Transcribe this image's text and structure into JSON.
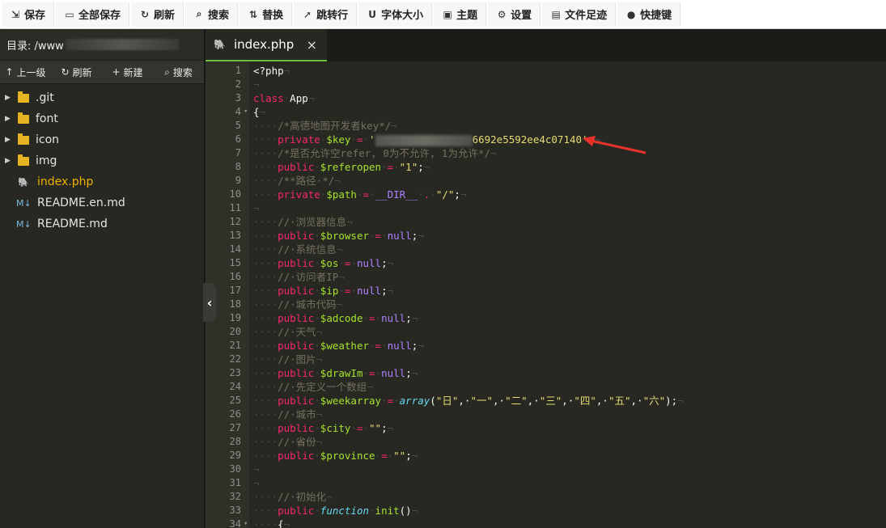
{
  "toolbar": {
    "items": [
      {
        "label": "保存",
        "icon": "save-icon",
        "glyph": "⇲"
      },
      {
        "label": "全部保存",
        "icon": "save-all-icon",
        "glyph": "▭"
      },
      {
        "label": "刷新",
        "icon": "refresh-icon",
        "glyph": "↻"
      },
      {
        "label": "搜索",
        "icon": "search-icon",
        "glyph": "⌕"
      },
      {
        "label": "替换",
        "icon": "replace-icon",
        "glyph": "⇅"
      },
      {
        "label": "跳转行",
        "icon": "goto-line-icon",
        "glyph": "➚"
      },
      {
        "label": "字体大小",
        "icon": "font-size-icon",
        "glyph": "U"
      },
      {
        "label": "主题",
        "icon": "theme-icon",
        "glyph": "▣"
      },
      {
        "label": "设置",
        "icon": "gear-icon",
        "glyph": "⚙"
      },
      {
        "label": "文件足迹",
        "icon": "history-icon",
        "glyph": "▤"
      },
      {
        "label": "快捷键",
        "icon": "help-icon",
        "glyph": "●"
      }
    ]
  },
  "sidebar": {
    "dir_label": "目录: /www",
    "actions": [
      {
        "label": "上一级",
        "icon": "up-arrow-icon",
        "glyph": "↑"
      },
      {
        "label": "刷新",
        "icon": "refresh-icon",
        "glyph": "↻"
      },
      {
        "label": "新建",
        "icon": "plus-icon",
        "glyph": "+"
      },
      {
        "label": "搜索",
        "icon": "search-icon",
        "glyph": "⌕"
      }
    ],
    "tree": [
      {
        "name": ".git",
        "type": "folder"
      },
      {
        "name": "font",
        "type": "folder"
      },
      {
        "name": "icon",
        "type": "folder"
      },
      {
        "name": "img",
        "type": "folder"
      },
      {
        "name": "index.php",
        "type": "php",
        "active": true
      },
      {
        "name": "README.en.md",
        "type": "md"
      },
      {
        "name": "README.md",
        "type": "md"
      }
    ]
  },
  "tabs": [
    {
      "label": "index.php",
      "close": "×"
    }
  ],
  "collapse_glyph": "‹",
  "code_lines": [
    {
      "n": "1",
      "tokens": [
        [
          "",
          "<?php"
        ]
      ]
    },
    {
      "n": "2",
      "tokens": []
    },
    {
      "n": "3",
      "tokens": [
        [
          "kw",
          "class"
        ],
        [
          "ws",
          "·"
        ],
        [
          "",
          "App"
        ]
      ]
    },
    {
      "n": "4",
      "fold": true,
      "tokens": [
        [
          "",
          "{"
        ]
      ]
    },
    {
      "n": "5",
      "tokens": [
        [
          "ws",
          "····"
        ],
        [
          "cm",
          "/*高德地图开发者key*/"
        ]
      ]
    },
    {
      "n": "6",
      "key": true,
      "tokens": [
        [
          "ws",
          "····"
        ],
        [
          "kw",
          "private"
        ],
        [
          "ws",
          "·"
        ],
        [
          "var",
          "$key"
        ],
        [
          "ws",
          "·"
        ],
        [
          "kw",
          "="
        ],
        [
          "ws",
          "·"
        ],
        [
          "str",
          "'"
        ],
        [
          "redact",
          ""
        ],
        [
          "str",
          "6692e5592ee4c07140'"
        ],
        [
          "",
          ";"
        ]
      ]
    },
    {
      "n": "7",
      "tokens": [
        [
          "ws",
          "····"
        ],
        [
          "cm",
          "/*是否允许空refer, 0为不允许, 1为允许*/"
        ]
      ]
    },
    {
      "n": "8",
      "tokens": [
        [
          "ws",
          "····"
        ],
        [
          "kw",
          "public"
        ],
        [
          "ws",
          "·"
        ],
        [
          "var",
          "$referopen"
        ],
        [
          "ws",
          "·"
        ],
        [
          "kw",
          "="
        ],
        [
          "ws",
          "·"
        ],
        [
          "str",
          "\"1\""
        ],
        [
          "",
          ";"
        ]
      ]
    },
    {
      "n": "9",
      "tokens": [
        [
          "ws",
          "····"
        ],
        [
          "cm",
          "/**路径·*/"
        ]
      ]
    },
    {
      "n": "10",
      "tokens": [
        [
          "ws",
          "····"
        ],
        [
          "kw",
          "private"
        ],
        [
          "ws",
          "·"
        ],
        [
          "var",
          "$path"
        ],
        [
          "ws",
          "·"
        ],
        [
          "kw",
          "="
        ],
        [
          "ws",
          "·"
        ],
        [
          "num",
          "__DIR__"
        ],
        [
          "ws",
          "·"
        ],
        [
          "kw",
          "."
        ],
        [
          "ws",
          "·"
        ],
        [
          "str",
          "\"/\""
        ],
        [
          "",
          ";"
        ]
      ]
    },
    {
      "n": "11",
      "tokens": []
    },
    {
      "n": "12",
      "tokens": [
        [
          "ws",
          "····"
        ],
        [
          "cm",
          "//·浏览器信息"
        ]
      ]
    },
    {
      "n": "13",
      "tokens": [
        [
          "ws",
          "····"
        ],
        [
          "kw",
          "public"
        ],
        [
          "ws",
          "·"
        ],
        [
          "var",
          "$browser"
        ],
        [
          "ws",
          "·"
        ],
        [
          "kw",
          "="
        ],
        [
          "ws",
          "·"
        ],
        [
          "num",
          "null"
        ],
        [
          "",
          ";"
        ]
      ]
    },
    {
      "n": "14",
      "tokens": [
        [
          "ws",
          "····"
        ],
        [
          "cm",
          "//·系统信息"
        ]
      ]
    },
    {
      "n": "15",
      "tokens": [
        [
          "ws",
          "····"
        ],
        [
          "kw",
          "public"
        ],
        [
          "ws",
          "·"
        ],
        [
          "var",
          "$os"
        ],
        [
          "ws",
          "·"
        ],
        [
          "kw",
          "="
        ],
        [
          "ws",
          "·"
        ],
        [
          "num",
          "null"
        ],
        [
          "",
          ";"
        ]
      ]
    },
    {
      "n": "16",
      "tokens": [
        [
          "ws",
          "····"
        ],
        [
          "cm",
          "//·访问者IP"
        ]
      ]
    },
    {
      "n": "17",
      "tokens": [
        [
          "ws",
          "····"
        ],
        [
          "kw",
          "public"
        ],
        [
          "ws",
          "·"
        ],
        [
          "var",
          "$ip"
        ],
        [
          "ws",
          "·"
        ],
        [
          "kw",
          "="
        ],
        [
          "ws",
          "·"
        ],
        [
          "num",
          "null"
        ],
        [
          "",
          ";"
        ]
      ]
    },
    {
      "n": "18",
      "tokens": [
        [
          "ws",
          "····"
        ],
        [
          "cm",
          "//·城市代码"
        ]
      ]
    },
    {
      "n": "19",
      "tokens": [
        [
          "ws",
          "····"
        ],
        [
          "kw",
          "public"
        ],
        [
          "ws",
          "·"
        ],
        [
          "var",
          "$adcode"
        ],
        [
          "ws",
          "·"
        ],
        [
          "kw",
          "="
        ],
        [
          "ws",
          "·"
        ],
        [
          "num",
          "null"
        ],
        [
          "",
          ";"
        ]
      ]
    },
    {
      "n": "20",
      "tokens": [
        [
          "ws",
          "····"
        ],
        [
          "cm",
          "//·天气"
        ]
      ]
    },
    {
      "n": "21",
      "tokens": [
        [
          "ws",
          "····"
        ],
        [
          "kw",
          "public"
        ],
        [
          "ws",
          "·"
        ],
        [
          "var",
          "$weather"
        ],
        [
          "ws",
          "·"
        ],
        [
          "kw",
          "="
        ],
        [
          "ws",
          "·"
        ],
        [
          "num",
          "null"
        ],
        [
          "",
          ";"
        ]
      ]
    },
    {
      "n": "22",
      "tokens": [
        [
          "ws",
          "····"
        ],
        [
          "cm",
          "//·图片"
        ]
      ]
    },
    {
      "n": "23",
      "tokens": [
        [
          "ws",
          "····"
        ],
        [
          "kw",
          "public"
        ],
        [
          "ws",
          "·"
        ],
        [
          "var",
          "$drawIm"
        ],
        [
          "ws",
          "·"
        ],
        [
          "kw",
          "="
        ],
        [
          "ws",
          "·"
        ],
        [
          "num",
          "null"
        ],
        [
          "",
          ";"
        ]
      ]
    },
    {
      "n": "24",
      "tokens": [
        [
          "ws",
          "····"
        ],
        [
          "cm",
          "//·先定义一个数组"
        ]
      ]
    },
    {
      "n": "25",
      "tokens": [
        [
          "ws",
          "····"
        ],
        [
          "kw",
          "public"
        ],
        [
          "ws",
          "·"
        ],
        [
          "var",
          "$weekarray"
        ],
        [
          "ws",
          "·"
        ],
        [
          "kw",
          "="
        ],
        [
          "ws",
          "·"
        ],
        [
          "cls",
          "array"
        ],
        [
          "",
          "("
        ],
        [
          "str",
          "\"日\""
        ],
        [
          "",
          ",·"
        ],
        [
          "str",
          "\"一\""
        ],
        [
          "",
          ",·"
        ],
        [
          "str",
          "\"二\""
        ],
        [
          "",
          ",·"
        ],
        [
          "str",
          "\"三\""
        ],
        [
          "",
          ",·"
        ],
        [
          "str",
          "\"四\""
        ],
        [
          "",
          ",·"
        ],
        [
          "str",
          "\"五\""
        ],
        [
          "",
          ",·"
        ],
        [
          "str",
          "\"六\""
        ],
        [
          "",
          ");"
        ]
      ]
    },
    {
      "n": "26",
      "tokens": [
        [
          "ws",
          "····"
        ],
        [
          "cm",
          "//·城市"
        ]
      ]
    },
    {
      "n": "27",
      "tokens": [
        [
          "ws",
          "····"
        ],
        [
          "kw",
          "public"
        ],
        [
          "ws",
          "·"
        ],
        [
          "var",
          "$city"
        ],
        [
          "ws",
          "·"
        ],
        [
          "kw",
          "="
        ],
        [
          "ws",
          "·"
        ],
        [
          "str",
          "\"\""
        ],
        [
          "",
          ";"
        ]
      ]
    },
    {
      "n": "28",
      "tokens": [
        [
          "ws",
          "····"
        ],
        [
          "cm",
          "//·省份"
        ]
      ]
    },
    {
      "n": "29",
      "tokens": [
        [
          "ws",
          "····"
        ],
        [
          "kw",
          "public"
        ],
        [
          "ws",
          "·"
        ],
        [
          "var",
          "$province"
        ],
        [
          "ws",
          "·"
        ],
        [
          "kw",
          "="
        ],
        [
          "ws",
          "·"
        ],
        [
          "str",
          "\"\""
        ],
        [
          "",
          ";"
        ]
      ]
    },
    {
      "n": "30",
      "tokens": []
    },
    {
      "n": "31",
      "tokens": []
    },
    {
      "n": "32",
      "tokens": [
        [
          "ws",
          "····"
        ],
        [
          "cm",
          "//·初始化"
        ]
      ]
    },
    {
      "n": "33",
      "tokens": [
        [
          "ws",
          "····"
        ],
        [
          "kw",
          "public"
        ],
        [
          "ws",
          "·"
        ],
        [
          "cls",
          "function"
        ],
        [
          "ws",
          "·"
        ],
        [
          "var",
          "init"
        ],
        [
          "",
          "()"
        ]
      ]
    },
    {
      "n": "34",
      "fold": true,
      "tokens": [
        [
          "ws",
          "····"
        ],
        [
          "",
          "{"
        ]
      ]
    }
  ]
}
